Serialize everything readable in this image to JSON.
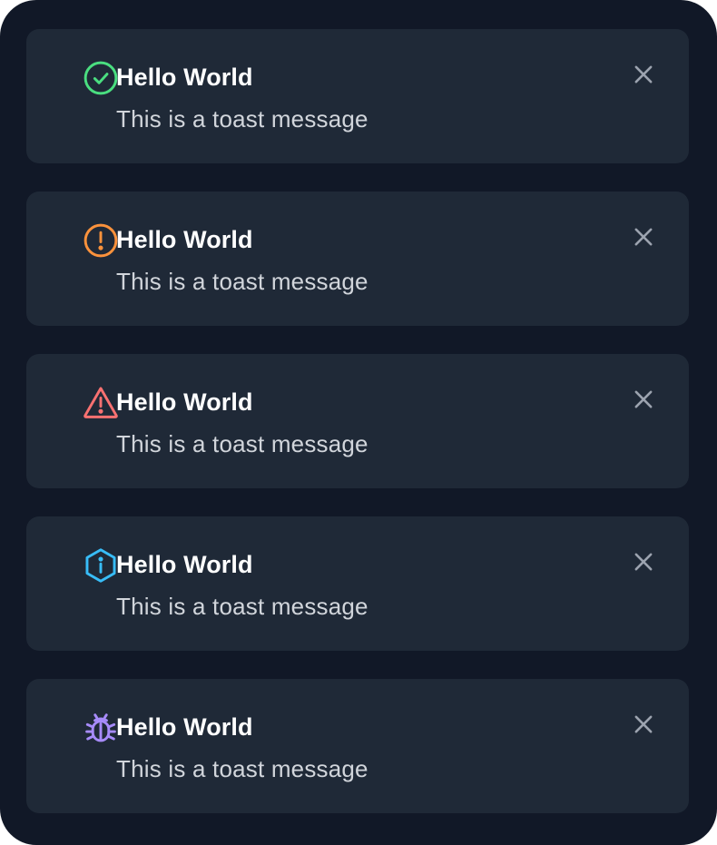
{
  "toasts": [
    {
      "type": "success",
      "icon": "check-circle-icon",
      "color": "#4ade80",
      "title": "Hello World",
      "message": "This is a toast message"
    },
    {
      "type": "warning",
      "icon": "exclamation-circle-icon",
      "color": "#fb923c",
      "title": "Hello World",
      "message": "This is a toast message"
    },
    {
      "type": "error",
      "icon": "warning-triangle-icon",
      "color": "#f87171",
      "title": "Hello World",
      "message": "This is a toast message"
    },
    {
      "type": "info",
      "icon": "info-hexagon-icon",
      "color": "#38bdf8",
      "title": "Hello World",
      "message": "This is a toast message"
    },
    {
      "type": "debug",
      "icon": "bug-icon",
      "color": "#a78bfa",
      "title": "Hello World",
      "message": "This is a toast message"
    }
  ],
  "close_icon": "close-icon",
  "colors": {
    "background": "#111827",
    "card": "#1f2937",
    "title": "#ffffff",
    "message": "#d1d5db",
    "close": "#9ca3af"
  }
}
